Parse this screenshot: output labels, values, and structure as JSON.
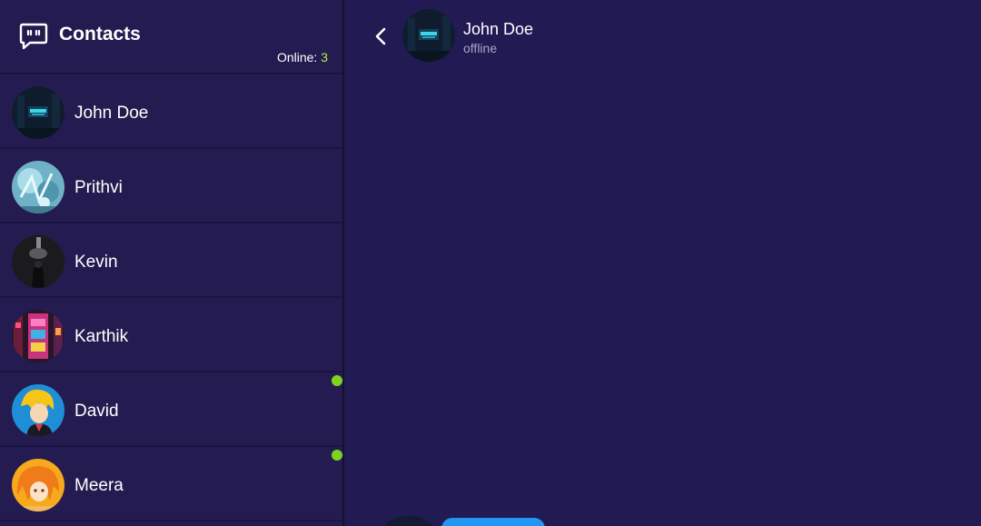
{
  "sidebar": {
    "title": "Contacts",
    "header_icon": "chat-bubble-icon",
    "online_label": "Online: ",
    "online_count": "3",
    "contacts": [
      {
        "name": "John Doe",
        "online": false
      },
      {
        "name": "Prithvi",
        "online": false
      },
      {
        "name": "Kevin",
        "online": false
      },
      {
        "name": "Karthik",
        "online": false
      },
      {
        "name": "David",
        "online": true
      },
      {
        "name": "Meera",
        "online": true
      }
    ]
  },
  "chat": {
    "back_icon": "chevron-left-icon",
    "name": "John Doe",
    "status": "offline"
  },
  "colors": {
    "background": "#221a52",
    "sidebar": "#241c50",
    "online_accent": "#b7f23a",
    "online_dot": "#7ed321",
    "bubble": "#2196f3"
  }
}
